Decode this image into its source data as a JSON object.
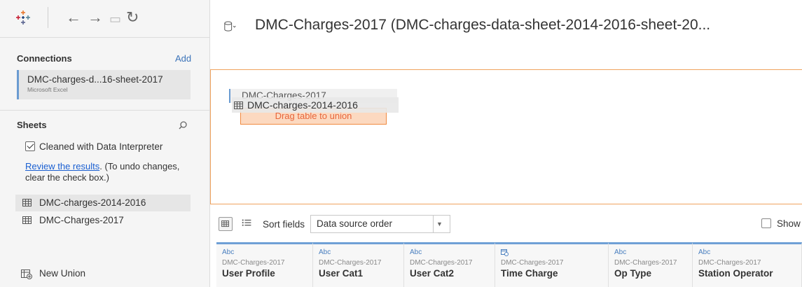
{
  "toolbar": {
    "logo_icon": "tableau-logo-icon",
    "back_icon": "back-arrow-icon",
    "forward_icon": "forward-arrow-icon",
    "save_icon": "save-icon",
    "refresh_icon": "refresh-icon",
    "glyphs": {
      "back": "←",
      "forward": "→",
      "save": "▭",
      "refresh": "↻"
    }
  },
  "connections": {
    "title": "Connections",
    "add_label": "Add",
    "items": [
      {
        "name": "DMC-charges-d...16-sheet-2017",
        "type": "Microsoft Excel"
      }
    ]
  },
  "sheets": {
    "title": "Sheets",
    "interpreter_label": "Cleaned with Data Interpreter",
    "interpreter_checked": true,
    "review_link": "Review the results",
    "review_note": ". (To undo changes, clear the check box.)",
    "items": [
      {
        "label": "DMC-charges-2014-2016",
        "selected": true
      },
      {
        "label": "DMC-Charges-2017",
        "selected": false
      }
    ],
    "new_union_label": "New Union"
  },
  "main": {
    "datasource_title": "DMC-Charges-2017 (DMC-charges-data-sheet-2014-2016-sheet-20...",
    "canvas": {
      "table_name": "DMC-Charges-2017",
      "dragged_table": "DMC-charges-2014-2016",
      "union_hint": "Drag table to union"
    },
    "grid_toolbar": {
      "sort_label": "Sort fields",
      "sort_value": "Data source order",
      "show_label": "Show"
    },
    "columns": [
      {
        "type": "Abc",
        "source": "DMC-Charges-2017",
        "name": "User Profile"
      },
      {
        "type": "Abc",
        "source": "DMC-Charges-2017",
        "name": "User Cat1"
      },
      {
        "type": "Abc",
        "source": "DMC-Charges-2017",
        "name": "User Cat2"
      },
      {
        "type": "datetime-icon",
        "source": "DMC-Charges-2017",
        "name": "Time Charge"
      },
      {
        "type": "Abc",
        "source": "DMC-Charges-2017",
        "name": "Op Type"
      },
      {
        "type": "Abc",
        "source": "DMC-Charges-2017",
        "name": "Station Operator"
      }
    ]
  },
  "colors": {
    "accent_blue": "#6fa0d6",
    "link_blue": "#1a5fd1",
    "union_orange": "#f08a40",
    "canvas_border": "#f0a35e"
  }
}
